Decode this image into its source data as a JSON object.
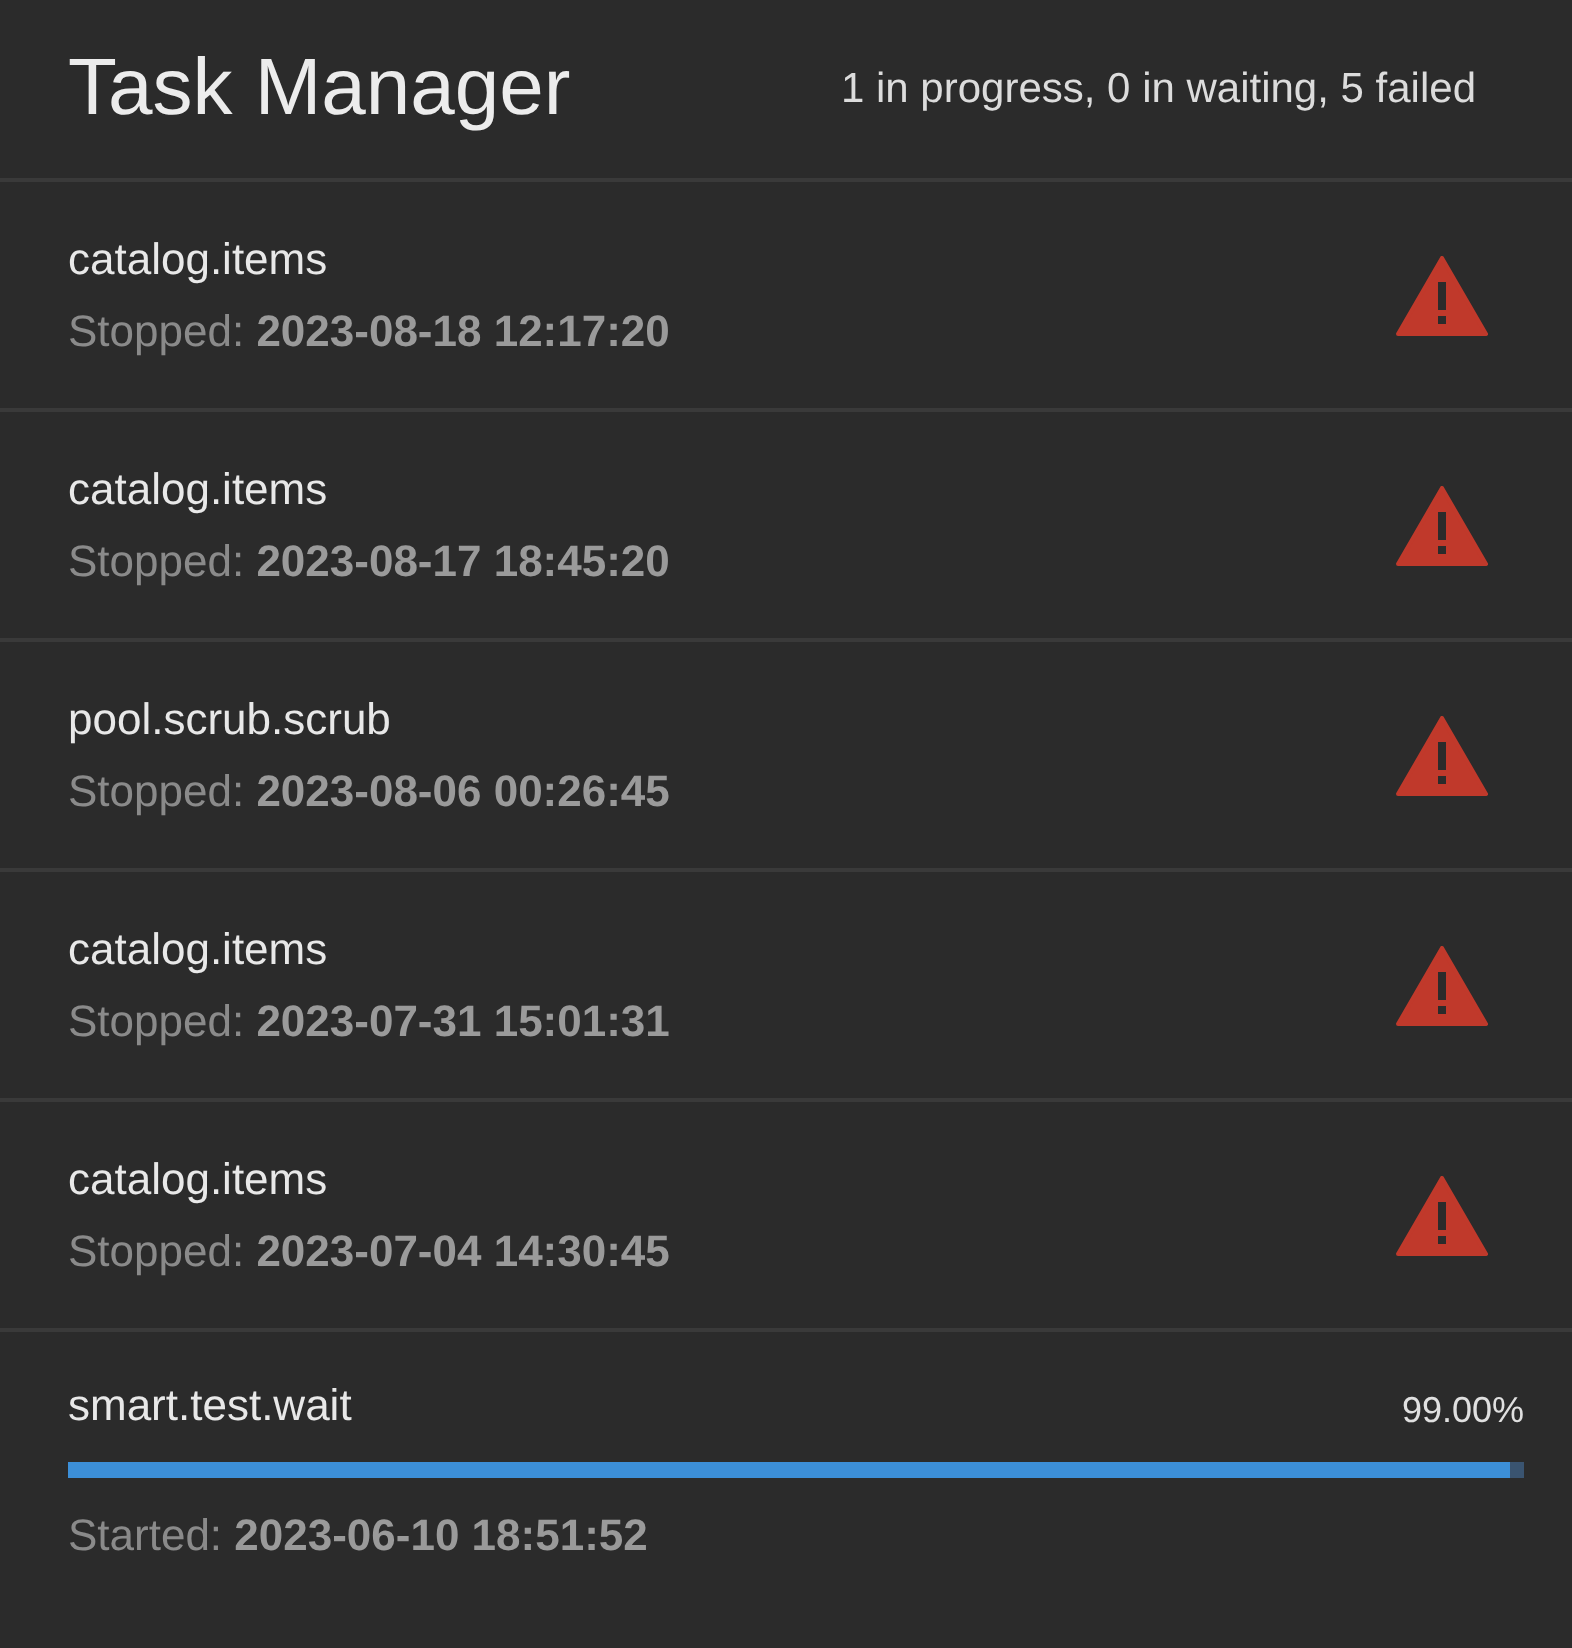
{
  "header": {
    "title": "Task Manager",
    "summary": "1 in progress, 0 in waiting, 5 failed"
  },
  "tasks": [
    {
      "kind": "failed",
      "name": "catalog.items",
      "status": "Stopped: **2023-08-18 12:17:20**"
    },
    {
      "kind": "failed",
      "name": "catalog.items",
      "status": "Stopped: **2023-08-17 18:45:20**"
    },
    {
      "kind": "failed",
      "name": "pool.scrub.scrub",
      "status": "Stopped: **2023-08-06 00:26:45**"
    },
    {
      "kind": "failed",
      "name": "catalog.items",
      "status": "Stopped: **2023-07-31 15:01:31**"
    },
    {
      "kind": "failed",
      "name": "catalog.items",
      "status": "Stopped: **2023-07-04 14:30:45**"
    },
    {
      "kind": "running",
      "name": "smart.test.wait",
      "percent": "99.00%",
      "level": 0.99,
      "status": "Started: **2023-06-10 18:51:52**"
    }
  ]
}
